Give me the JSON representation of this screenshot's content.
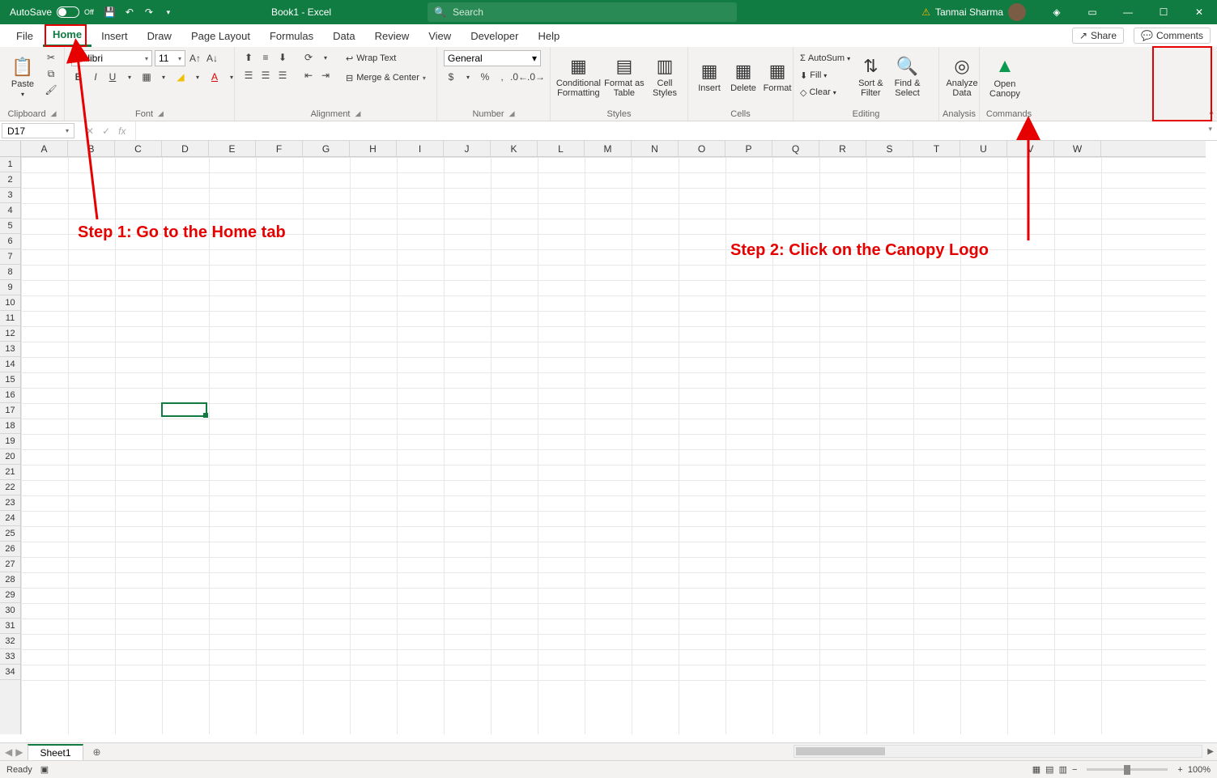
{
  "titlebar": {
    "autosave_label": "AutoSave",
    "autosave_toggle_text": "Off",
    "document_title": "Book1  -  Excel",
    "search_placeholder": "Search",
    "user_name": "Tanmai Sharma"
  },
  "tabs": {
    "file": "File",
    "items": [
      "Home",
      "Insert",
      "Draw",
      "Page Layout",
      "Formulas",
      "Data",
      "Review",
      "View",
      "Developer",
      "Help"
    ],
    "active_index": 0,
    "share": "Share",
    "comments": "Comments"
  },
  "ribbon": {
    "clipboard": {
      "label": "Clipboard",
      "paste": "Paste"
    },
    "font": {
      "label": "Font",
      "font_name": "Calibri",
      "font_size": "11"
    },
    "alignment": {
      "label": "Alignment",
      "wrap": "Wrap Text",
      "merge": "Merge & Center"
    },
    "number": {
      "label": "Number",
      "format": "General"
    },
    "styles": {
      "label": "Styles",
      "conditional": "Conditional\nFormatting",
      "format_table": "Format as\nTable",
      "cell_styles": "Cell\nStyles"
    },
    "cells": {
      "label": "Cells",
      "insert": "Insert",
      "delete": "Delete",
      "format": "Format"
    },
    "editing": {
      "label": "Editing",
      "autosum": "AutoSum",
      "fill": "Fill",
      "clear": "Clear",
      "sort": "Sort &\nFilter",
      "find": "Find &\nSelect"
    },
    "analysis": {
      "label": "Analysis",
      "analyze": "Analyze\nData"
    },
    "commands": {
      "label": "Commands",
      "canopy": "Open\nCanopy"
    }
  },
  "namebox": "D17",
  "columns": [
    "A",
    "B",
    "C",
    "D",
    "E",
    "F",
    "G",
    "H",
    "I",
    "J",
    "K",
    "L",
    "M",
    "N",
    "O",
    "P",
    "Q",
    "R",
    "S",
    "T",
    "U",
    "V",
    "W"
  ],
  "rows": [
    "1",
    "2",
    "3",
    "4",
    "5",
    "6",
    "7",
    "8",
    "9",
    "10",
    "11",
    "12",
    "13",
    "14",
    "15",
    "16",
    "17",
    "18",
    "19",
    "20",
    "21",
    "22",
    "23",
    "24",
    "25",
    "26",
    "27",
    "28",
    "29",
    "30",
    "31",
    "32",
    "33",
    "34"
  ],
  "selected_cell": {
    "col": 3,
    "row": 16
  },
  "sheet": {
    "name": "Sheet1"
  },
  "statusbar": {
    "ready": "Ready",
    "zoom": "100%"
  },
  "annotations": {
    "step1": "Step 1: Go to the Home tab",
    "step2": "Step 2: Click on the Canopy Logo"
  }
}
